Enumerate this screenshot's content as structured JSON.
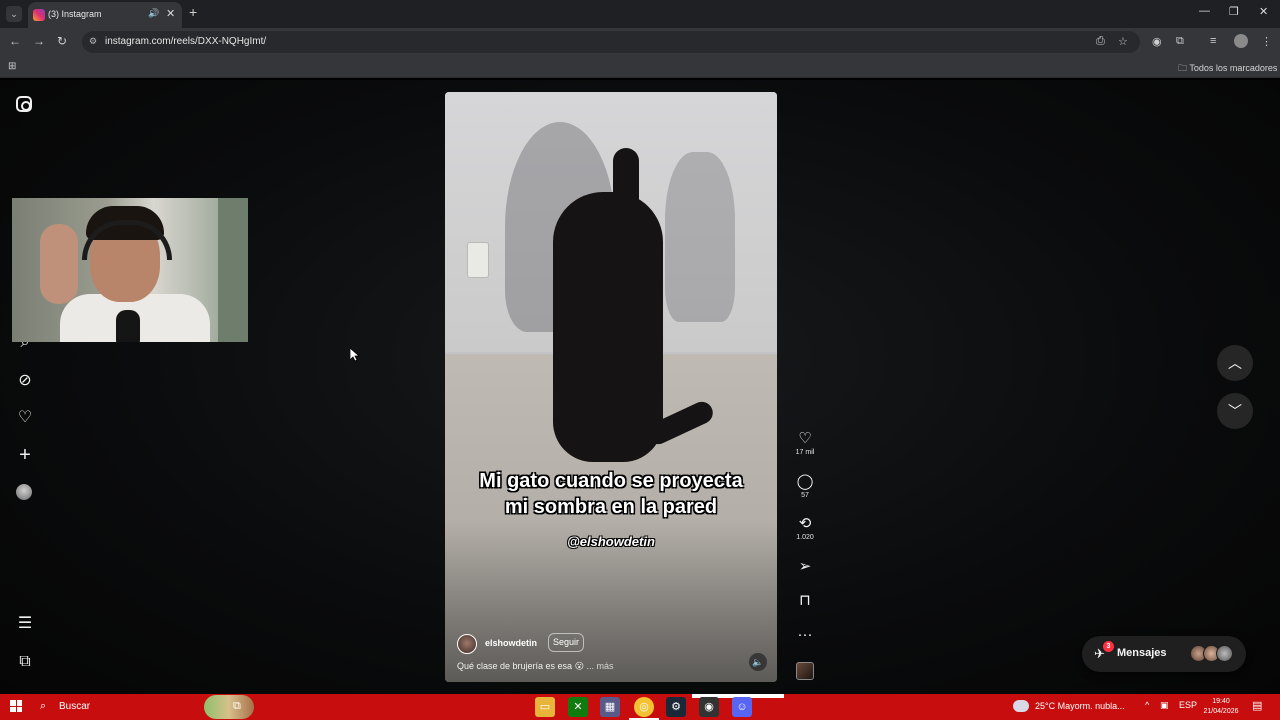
{
  "browser": {
    "tab_title": "(3) Instagram",
    "tab_close": "✕",
    "new_tab": "+",
    "url": "instagram.com/reels/DXX-NQHgImt/",
    "bookmarks_all": "Todos los marcadores",
    "window_controls": [
      "—",
      "❐",
      "✕"
    ]
  },
  "sidebar": {
    "items": [
      {
        "name": "instagram-logo",
        "icon": "instagram-icon"
      },
      {
        "name": "search",
        "icon": "search-icon",
        "glyph": "⌕"
      },
      {
        "name": "explore",
        "icon": "compass-icon",
        "glyph": "⊘"
      },
      {
        "name": "notifications",
        "icon": "heart-icon",
        "glyph": "♡"
      },
      {
        "name": "create",
        "icon": "plus-icon",
        "glyph": "+"
      },
      {
        "name": "profile",
        "icon": "avatar-icon"
      },
      {
        "name": "more",
        "icon": "menu-icon",
        "glyph": "☰"
      },
      {
        "name": "also-from-meta",
        "icon": "grid-icon",
        "glyph": "⧉"
      }
    ]
  },
  "reel": {
    "caption_line1": "Mi gato cuando se proyecta",
    "caption_line2": "mi sombra en la pared",
    "overlay_handle": "@elshowdetin",
    "author": "elshowdetin",
    "follow_label": "Seguir",
    "description": "Qué clase de brujería es esa 😮",
    "more_label": "... más",
    "mute_glyph": "🔈"
  },
  "actions": {
    "like_count": "17 mil",
    "comment_count": "57",
    "repost_count": "1.020",
    "like_glyph": "♡",
    "comment_glyph": "◯",
    "repost_glyph": "⟲",
    "share_glyph": "➢",
    "save_glyph": "⊓",
    "more_glyph": "···"
  },
  "nav": {
    "up_glyph": "︿",
    "down_glyph": "﹀"
  },
  "messages": {
    "label": "Mensajes",
    "badge": "3",
    "icon_glyph": "✈"
  },
  "taskbar": {
    "search_placeholder": "Buscar",
    "weather": "25°C  Mayorm. nubla...",
    "language": "ESP",
    "time": "19:40",
    "date": "21/04/2026"
  },
  "colors": {
    "taskbar": "#c70d0d",
    "badge": "#ff3040",
    "page_bg": "#0a0b0c"
  }
}
